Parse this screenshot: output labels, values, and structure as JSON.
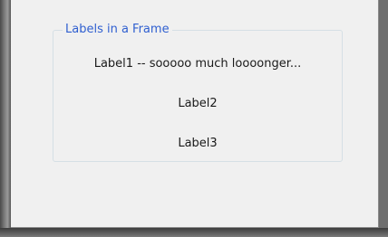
{
  "groupbox": {
    "title": "Labels in a Frame",
    "labels": [
      "Label1 -- sooooo much loooonger...",
      "Label2",
      "Label3"
    ]
  },
  "colors": {
    "groupbox_title": "#2f5fd0",
    "window_background": "#f0f0f0",
    "groupbox_border": "#d5dfe5"
  }
}
